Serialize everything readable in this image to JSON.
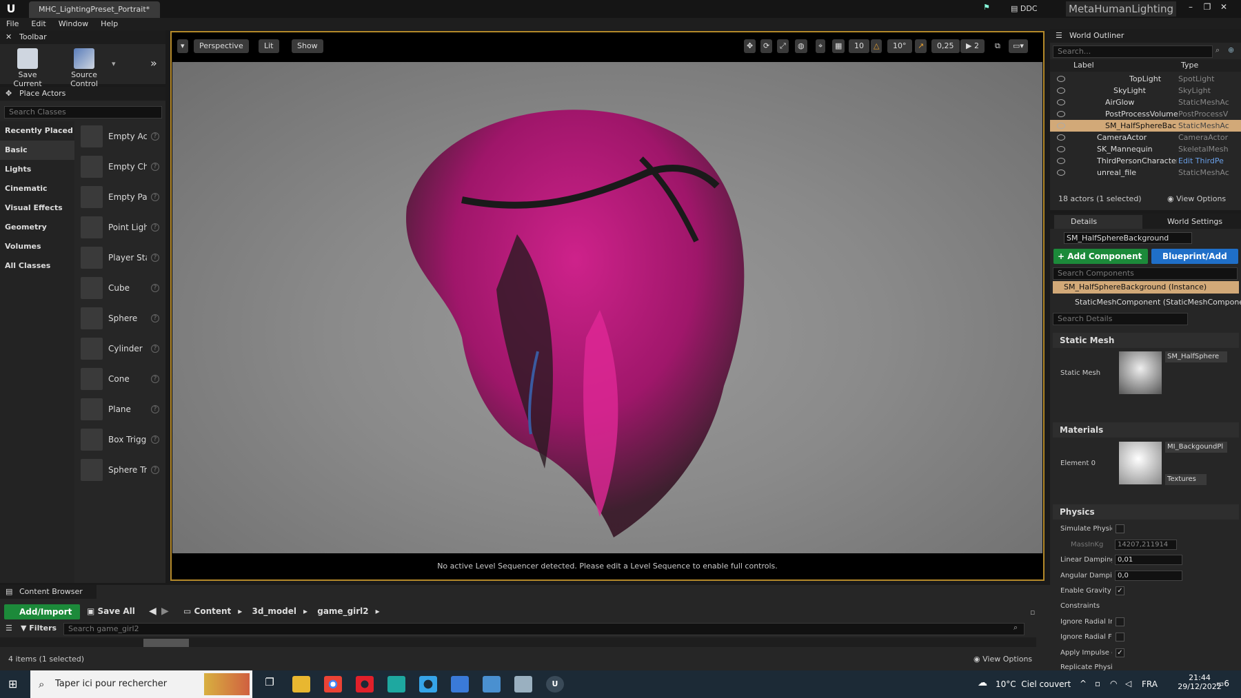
{
  "window": {
    "doc_tab": "MHC_LightingPreset_Portrait*",
    "ddc": "DDC",
    "brand": "MetaHumanLighting",
    "menus": [
      "File",
      "Edit",
      "Window",
      "Help"
    ]
  },
  "toolbar": {
    "title": "Toolbar",
    "save": "Save Current",
    "source": "Source Control"
  },
  "place_actors": {
    "title": "Place Actors",
    "search_placeholder": "Search Classes",
    "categories": [
      "Recently Placed",
      "Basic",
      "Lights",
      "Cinematic",
      "Visual Effects",
      "Geometry",
      "Volumes",
      "All Classes"
    ],
    "items": [
      "Empty Act",
      "Empty Cha",
      "Empty Pav",
      "Point Light",
      "Player Sta",
      "Cube",
      "Sphere",
      "Cylinder",
      "Cone",
      "Plane",
      "Box Trigge",
      "Sphere Tr"
    ]
  },
  "viewport": {
    "perspective": "Perspective",
    "lit": "Lit",
    "show": "Show",
    "grid": "10",
    "angle": "10°",
    "scale": "0,25",
    "cams": "2",
    "status": "No active Level Sequencer detected. Please edit a Level Sequence to enable full controls."
  },
  "outliner": {
    "title": "World Outliner",
    "search_placeholder": "Search...",
    "col_label": "Label",
    "col_type": "Type",
    "rows": [
      {
        "label": "TopLight",
        "type": "SpotLight"
      },
      {
        "label": "SkyLight",
        "type": "SkyLight"
      },
      {
        "label": "AirGlow",
        "type": "StaticMeshAc"
      },
      {
        "label": "PostProcessVolume",
        "type": "PostProcessV"
      },
      {
        "label": "SM_HalfSphereBackg",
        "type": "StaticMeshAc"
      },
      {
        "label": "CameraActor",
        "type": "CameraActor"
      },
      {
        "label": "SK_Mannequin",
        "type": "SkeletalMesh"
      },
      {
        "label": "ThirdPersonCharacter",
        "type": "Edit ThirdPe"
      },
      {
        "label": "unreal_file",
        "type": "StaticMeshAc"
      }
    ],
    "count": "18 actors (1 selected)",
    "view_options": "View Options"
  },
  "details": {
    "tab_details": "Details",
    "tab_world": "World Settings",
    "name": "SM_HalfSphereBackground",
    "add_component": "+ Add Component",
    "blueprint": "Blueprint/Add",
    "search_components": "Search Components",
    "instance": "SM_HalfSphereBackground (Instance)",
    "component": "StaticMeshComponent (StaticMeshComponent",
    "search_details": "Search Details",
    "static_mesh_h": "Static Mesh",
    "static_mesh_l": "Static Mesh",
    "static_mesh_v": "SM_HalfSphere",
    "materials_h": "Materials",
    "element0_l": "Element 0",
    "element0_v": "MI_BackgoundPl",
    "textures": "Textures",
    "physics_h": "Physics",
    "simulate": "Simulate Physic",
    "mass": "MassInKg",
    "mass_v": "14207,211914",
    "linear": "Linear Damping",
    "linear_v": "0,01",
    "angular": "Angular Dampin",
    "angular_v": "0,0",
    "gravity": "Enable Gravity",
    "constraints": "Constraints",
    "ignore_im": "Ignore Radial Im",
    "ignore_fo": "Ignore Radial Fo",
    "apply": "Apply Impulse o",
    "replicate": "Replicate Physic"
  },
  "content_browser": {
    "title": "Content Browser",
    "add_import": "Add/Import",
    "save_all": "Save All",
    "path": [
      "Content",
      "3d_model",
      "game_girl2"
    ],
    "filters": "Filters",
    "search_placeholder": "Search game_girl2",
    "count": "4 items (1 selected)",
    "view_options": "View Options"
  },
  "taskbar": {
    "search": "Taper ici pour rechercher",
    "weather": "10°C  Ciel couvert",
    "lang": "FRA",
    "time": "21:44",
    "date": "29/12/2022",
    "notif": "6"
  },
  "colors": {
    "accent": "#b58a2a",
    "hair": "#c2157a",
    "green": "#1c8a3a",
    "blue": "#1f6fc8"
  }
}
